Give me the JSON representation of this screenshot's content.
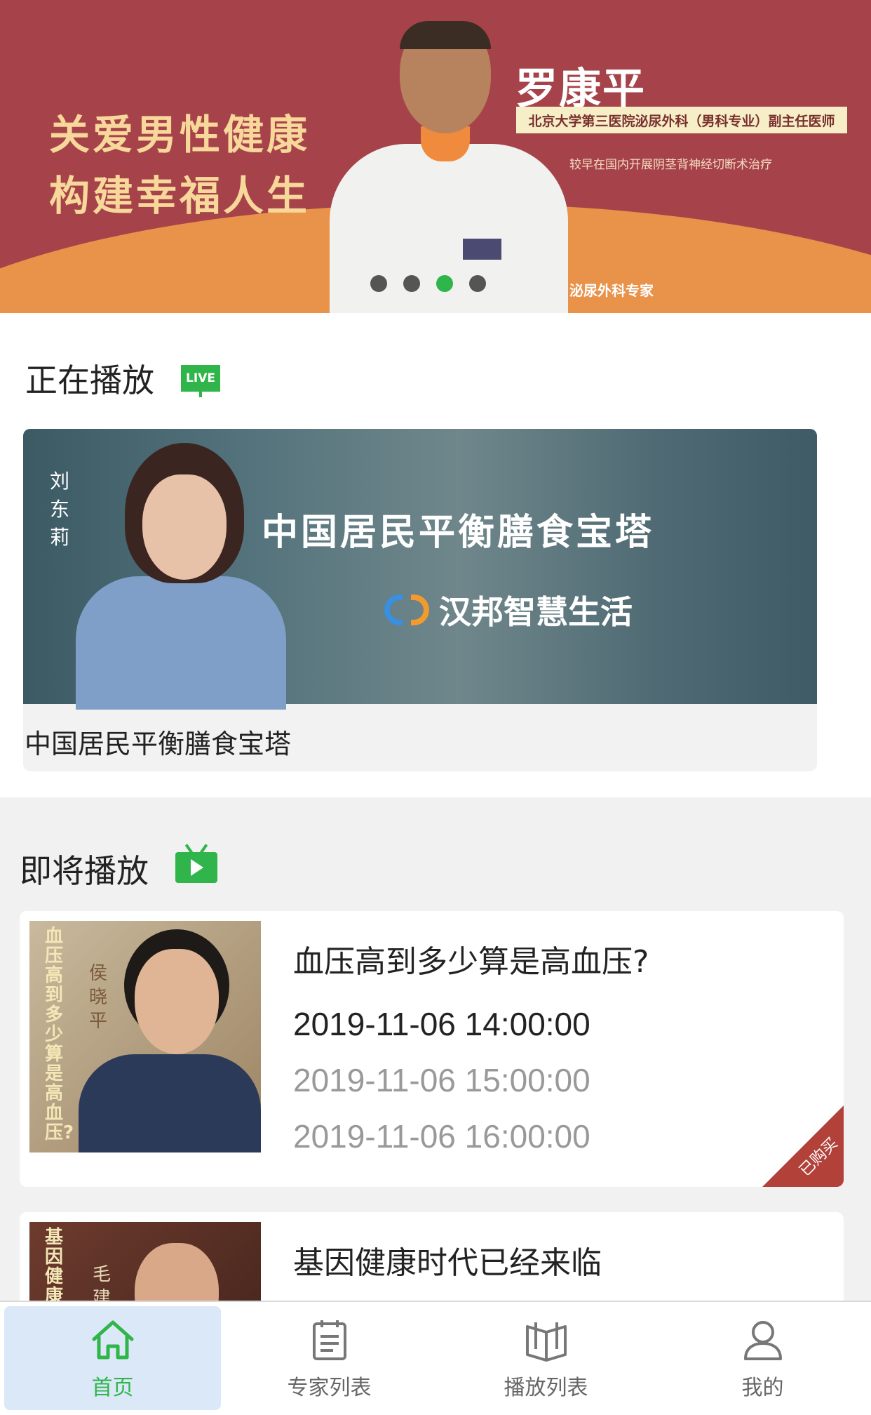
{
  "banner": {
    "slogan_line1": "关爱男性健康",
    "slogan_line2": "构建幸福人生",
    "doctor_name": "罗康平",
    "doctor_title": "北京大学第三医院泌尿外科（男科专业）副主任医师",
    "doctor_desc": "较早在国内开展阴茎背神经切断术治疗",
    "tag": "泌尿外科专家",
    "slides": 4,
    "active_slide": 3
  },
  "now_playing": {
    "section_title": "正在播放",
    "live_label": "LIVE",
    "cover_speaker": "刘东莉",
    "cover_title": "中国居民平衡膳食宝塔",
    "cover_brand": "汉邦智慧生活",
    "caption": "中国居民平衡膳食宝塔"
  },
  "upcoming": {
    "section_title": "即将播放",
    "items": [
      {
        "thumb_text": "血压高到多少算是高血压?",
        "thumb_speaker": "侯晓平",
        "title": "血压高到多少算是高血压?",
        "times": [
          "2019-11-06 14:00:00",
          "2019-11-06 15:00:00",
          "2019-11-06 16:00:00"
        ],
        "badge": "已购买"
      },
      {
        "thumb_text": "基因健康",
        "thumb_speaker": "毛建",
        "title": "基因健康时代已经来临"
      }
    ]
  },
  "tabbar": {
    "tabs": [
      {
        "label": "首页",
        "icon": "home-icon",
        "active": true
      },
      {
        "label": "专家列表",
        "icon": "list-icon",
        "active": false
      },
      {
        "label": "播放列表",
        "icon": "book-icon",
        "active": false
      },
      {
        "label": "我的",
        "icon": "user-icon",
        "active": false
      }
    ]
  },
  "colors": {
    "accent_green": "#2fb54a",
    "banner_red": "#a6434a",
    "banner_orange": "#e9924a",
    "badge_red": "#b2413a"
  }
}
